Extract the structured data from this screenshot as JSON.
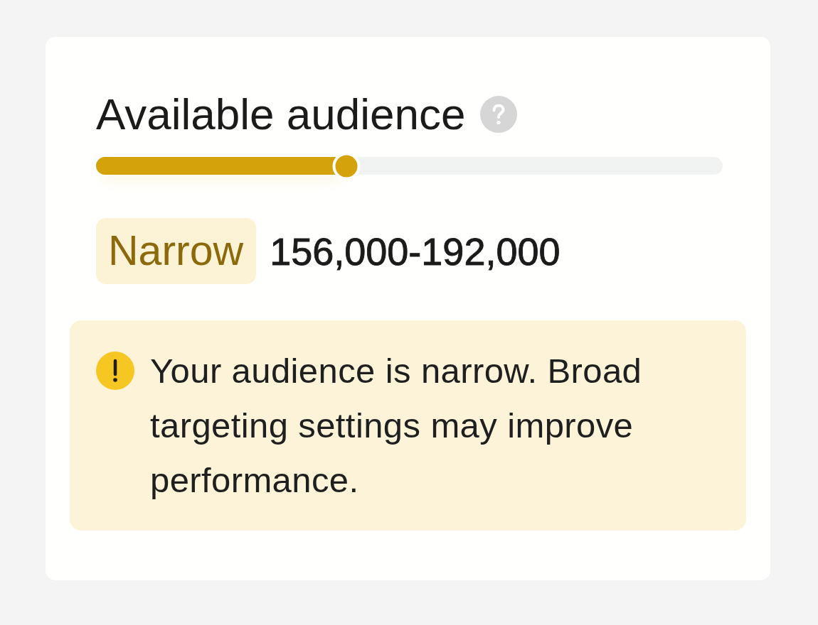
{
  "card": {
    "title": "Available audience",
    "audience_meter": {
      "level": 0.4
    },
    "audience_size": {
      "label": "Narrow",
      "range": "156,000-192,000"
    },
    "alert": {
      "message": "Your audience is narrow. Broad targeting settings may improve performance."
    }
  }
}
